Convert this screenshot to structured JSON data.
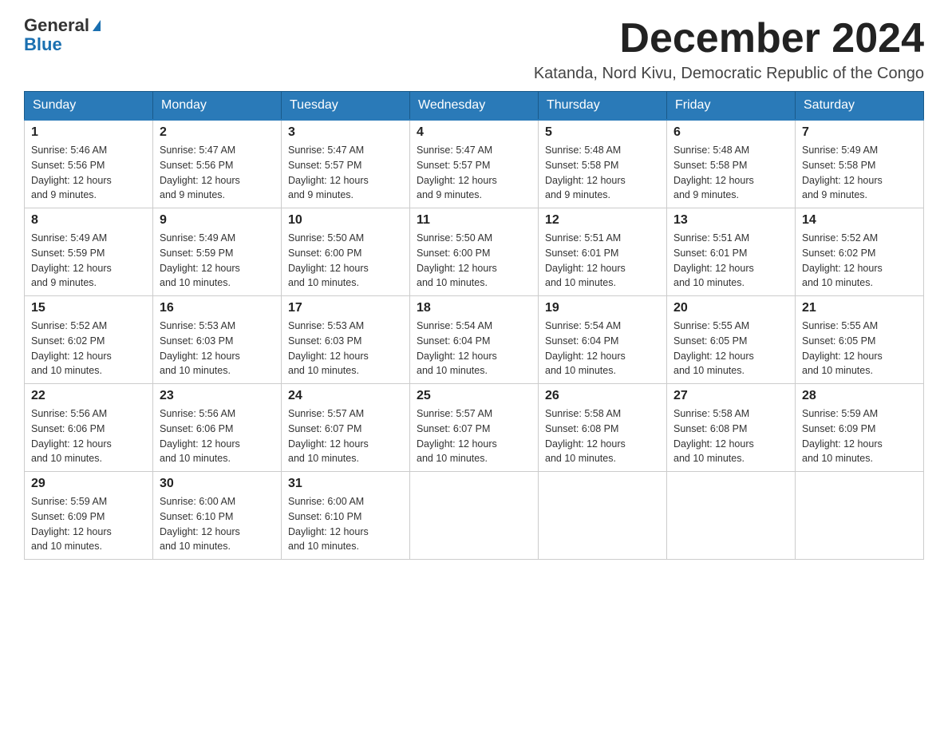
{
  "header": {
    "logo_general": "General",
    "logo_blue": "Blue",
    "month_title": "December 2024",
    "location": "Katanda, Nord Kivu, Democratic Republic of the Congo"
  },
  "weekdays": [
    "Sunday",
    "Monday",
    "Tuesday",
    "Wednesday",
    "Thursday",
    "Friday",
    "Saturday"
  ],
  "weeks": [
    [
      {
        "day": "1",
        "sunrise": "5:46 AM",
        "sunset": "5:56 PM",
        "daylight": "12 hours and 9 minutes."
      },
      {
        "day": "2",
        "sunrise": "5:47 AM",
        "sunset": "5:56 PM",
        "daylight": "12 hours and 9 minutes."
      },
      {
        "day": "3",
        "sunrise": "5:47 AM",
        "sunset": "5:57 PM",
        "daylight": "12 hours and 9 minutes."
      },
      {
        "day": "4",
        "sunrise": "5:47 AM",
        "sunset": "5:57 PM",
        "daylight": "12 hours and 9 minutes."
      },
      {
        "day": "5",
        "sunrise": "5:48 AM",
        "sunset": "5:58 PM",
        "daylight": "12 hours and 9 minutes."
      },
      {
        "day": "6",
        "sunrise": "5:48 AM",
        "sunset": "5:58 PM",
        "daylight": "12 hours and 9 minutes."
      },
      {
        "day": "7",
        "sunrise": "5:49 AM",
        "sunset": "5:58 PM",
        "daylight": "12 hours and 9 minutes."
      }
    ],
    [
      {
        "day": "8",
        "sunrise": "5:49 AM",
        "sunset": "5:59 PM",
        "daylight": "12 hours and 9 minutes."
      },
      {
        "day": "9",
        "sunrise": "5:49 AM",
        "sunset": "5:59 PM",
        "daylight": "12 hours and 10 minutes."
      },
      {
        "day": "10",
        "sunrise": "5:50 AM",
        "sunset": "6:00 PM",
        "daylight": "12 hours and 10 minutes."
      },
      {
        "day": "11",
        "sunrise": "5:50 AM",
        "sunset": "6:00 PM",
        "daylight": "12 hours and 10 minutes."
      },
      {
        "day": "12",
        "sunrise": "5:51 AM",
        "sunset": "6:01 PM",
        "daylight": "12 hours and 10 minutes."
      },
      {
        "day": "13",
        "sunrise": "5:51 AM",
        "sunset": "6:01 PM",
        "daylight": "12 hours and 10 minutes."
      },
      {
        "day": "14",
        "sunrise": "5:52 AM",
        "sunset": "6:02 PM",
        "daylight": "12 hours and 10 minutes."
      }
    ],
    [
      {
        "day": "15",
        "sunrise": "5:52 AM",
        "sunset": "6:02 PM",
        "daylight": "12 hours and 10 minutes."
      },
      {
        "day": "16",
        "sunrise": "5:53 AM",
        "sunset": "6:03 PM",
        "daylight": "12 hours and 10 minutes."
      },
      {
        "day": "17",
        "sunrise": "5:53 AM",
        "sunset": "6:03 PM",
        "daylight": "12 hours and 10 minutes."
      },
      {
        "day": "18",
        "sunrise": "5:54 AM",
        "sunset": "6:04 PM",
        "daylight": "12 hours and 10 minutes."
      },
      {
        "day": "19",
        "sunrise": "5:54 AM",
        "sunset": "6:04 PM",
        "daylight": "12 hours and 10 minutes."
      },
      {
        "day": "20",
        "sunrise": "5:55 AM",
        "sunset": "6:05 PM",
        "daylight": "12 hours and 10 minutes."
      },
      {
        "day": "21",
        "sunrise": "5:55 AM",
        "sunset": "6:05 PM",
        "daylight": "12 hours and 10 minutes."
      }
    ],
    [
      {
        "day": "22",
        "sunrise": "5:56 AM",
        "sunset": "6:06 PM",
        "daylight": "12 hours and 10 minutes."
      },
      {
        "day": "23",
        "sunrise": "5:56 AM",
        "sunset": "6:06 PM",
        "daylight": "12 hours and 10 minutes."
      },
      {
        "day": "24",
        "sunrise": "5:57 AM",
        "sunset": "6:07 PM",
        "daylight": "12 hours and 10 minutes."
      },
      {
        "day": "25",
        "sunrise": "5:57 AM",
        "sunset": "6:07 PM",
        "daylight": "12 hours and 10 minutes."
      },
      {
        "day": "26",
        "sunrise": "5:58 AM",
        "sunset": "6:08 PM",
        "daylight": "12 hours and 10 minutes."
      },
      {
        "day": "27",
        "sunrise": "5:58 AM",
        "sunset": "6:08 PM",
        "daylight": "12 hours and 10 minutes."
      },
      {
        "day": "28",
        "sunrise": "5:59 AM",
        "sunset": "6:09 PM",
        "daylight": "12 hours and 10 minutes."
      }
    ],
    [
      {
        "day": "29",
        "sunrise": "5:59 AM",
        "sunset": "6:09 PM",
        "daylight": "12 hours and 10 minutes."
      },
      {
        "day": "30",
        "sunrise": "6:00 AM",
        "sunset": "6:10 PM",
        "daylight": "12 hours and 10 minutes."
      },
      {
        "day": "31",
        "sunrise": "6:00 AM",
        "sunset": "6:10 PM",
        "daylight": "12 hours and 10 minutes."
      },
      null,
      null,
      null,
      null
    ]
  ],
  "labels": {
    "sunrise_prefix": "Sunrise: ",
    "sunset_prefix": "Sunset: ",
    "daylight_prefix": "Daylight: "
  }
}
